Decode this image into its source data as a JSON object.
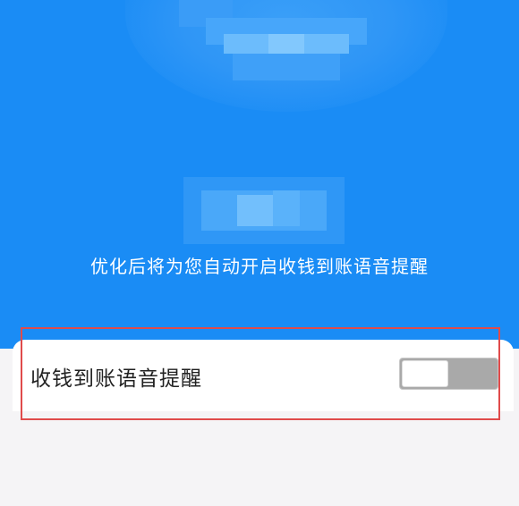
{
  "colors": {
    "hero_background": "#1a8cf5",
    "highlight_border": "#e04b4b",
    "toggle_track_off": "#a9a9a9"
  },
  "hero": {
    "caption": "优化后将为您自动开启收钱到账语音提醒"
  },
  "setting": {
    "label": "收钱到账语音提醒",
    "toggle_on": false
  }
}
